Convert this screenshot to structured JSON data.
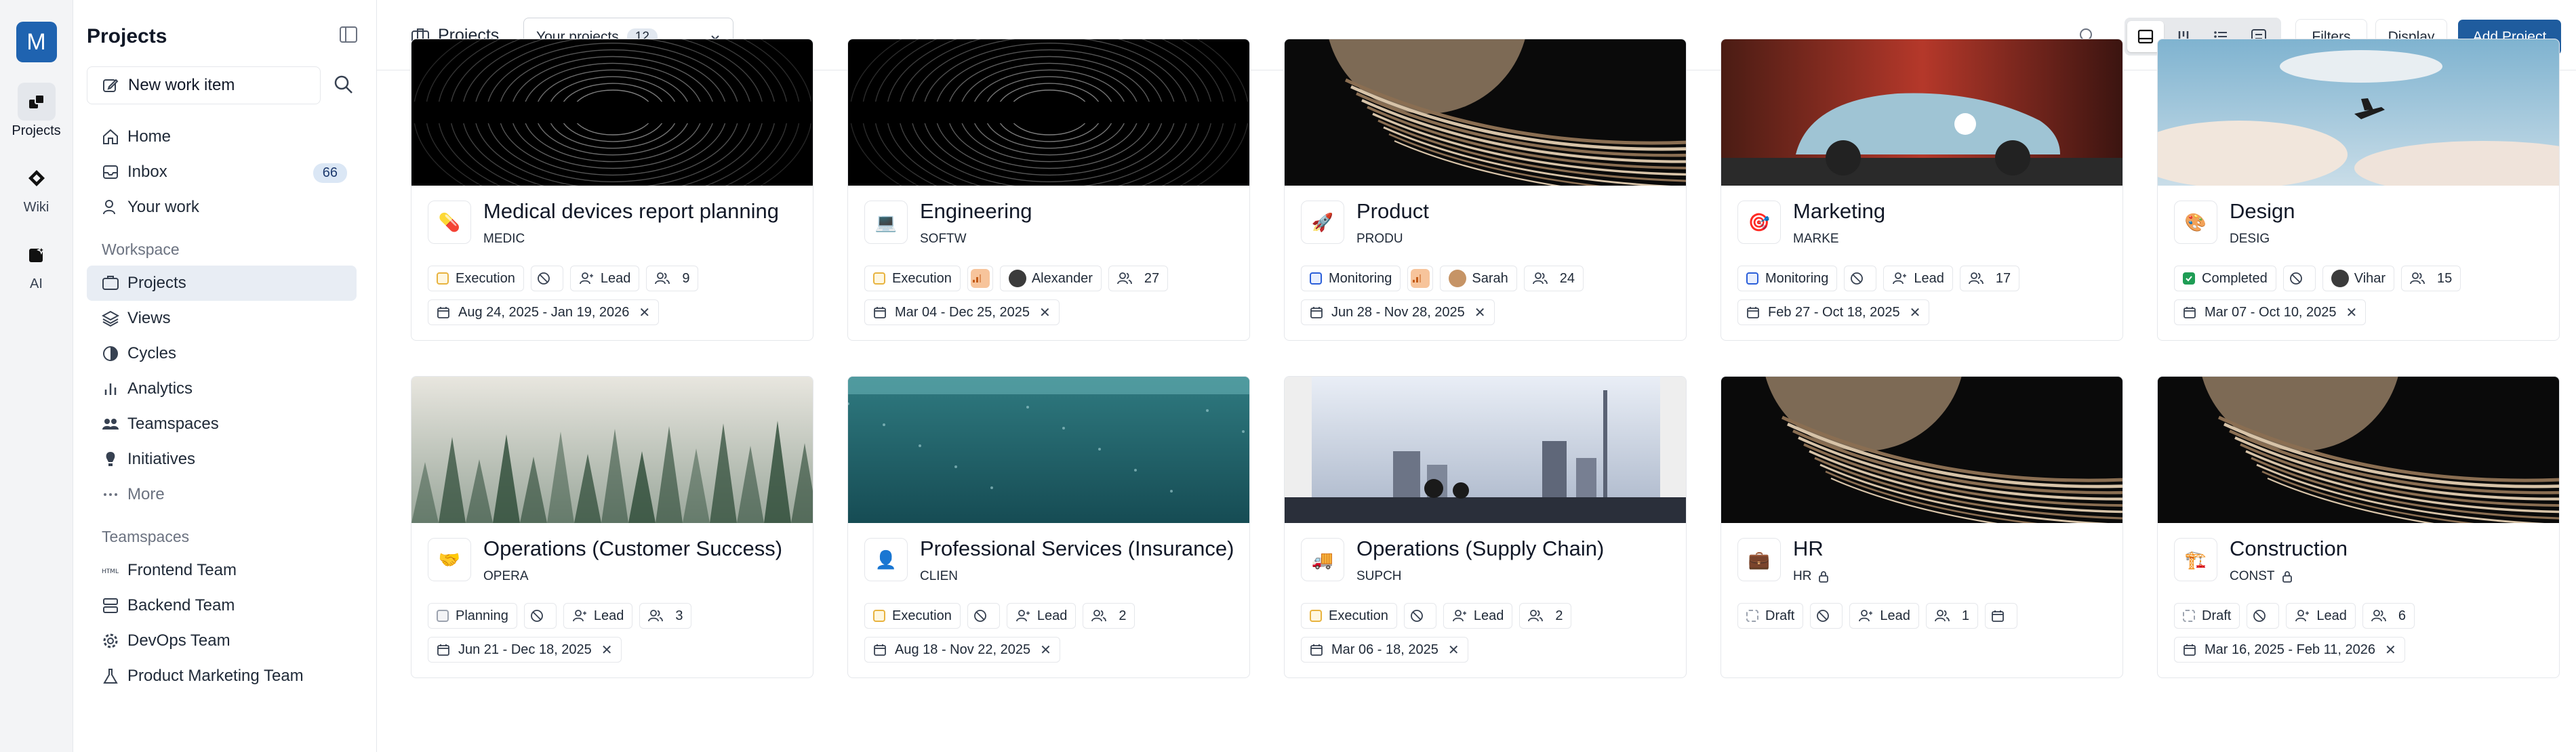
{
  "workspace": {
    "initial": "M"
  },
  "rail": [
    {
      "label": "Projects",
      "icon": "projects-icon",
      "active": true
    },
    {
      "label": "Wiki",
      "icon": "wiki-icon",
      "active": false
    },
    {
      "label": "AI",
      "icon": "ai-icon",
      "active": false
    }
  ],
  "sidebar": {
    "title": "Projects",
    "new_work_item": "New work item",
    "nav": [
      {
        "label": "Home",
        "icon": "home-icon"
      },
      {
        "label": "Inbox",
        "icon": "inbox-icon",
        "badge": "66"
      },
      {
        "label": "Your work",
        "icon": "user-icon"
      }
    ],
    "workspace_label": "Workspace",
    "workspace_items": [
      {
        "label": "Projects",
        "icon": "projects-icon",
        "active": true
      },
      {
        "label": "Views",
        "icon": "layers-icon"
      },
      {
        "label": "Cycles",
        "icon": "cycles-icon"
      },
      {
        "label": "Analytics",
        "icon": "analytics-icon"
      },
      {
        "label": "Teamspaces",
        "icon": "teamspaces-icon"
      },
      {
        "label": "Initiatives",
        "icon": "initiatives-icon"
      },
      {
        "label": "More",
        "icon": "more-icon"
      }
    ],
    "teamspaces_label": "Teamspaces",
    "teamspaces": [
      {
        "label": "Frontend Team",
        "icon": "html-icon"
      },
      {
        "label": "Backend Team",
        "icon": "server-icon"
      },
      {
        "label": "DevOps Team",
        "icon": "gear-icon"
      },
      {
        "label": "Product Marketing Team",
        "icon": "flask-icon"
      }
    ]
  },
  "topbar": {
    "title": "Projects",
    "filter_select": "Your projects",
    "filter_count": "12",
    "filters_label": "Filters",
    "display_label": "Display",
    "add_project_label": "Add Project"
  },
  "projects": [
    {
      "name": "Medical devices report planning",
      "identifier": "MEDIC",
      "emoji": "💊",
      "state": "Execution",
      "state_kind": "exec",
      "priority": "none",
      "lead": "Lead",
      "members": "9",
      "dates": "Aug 24, 2025 - Jan 19, 2026",
      "cover": "rings"
    },
    {
      "name": "Engineering",
      "identifier": "SOFTW",
      "emoji": "💻",
      "state": "Execution",
      "state_kind": "exec",
      "priority": "medium",
      "lead": "Alexander",
      "members": "27",
      "dates": "Mar 04 - Dec 25, 2025",
      "cover": "rings"
    },
    {
      "name": "Product",
      "identifier": "PRODU",
      "emoji": "🚀",
      "state": "Monitoring",
      "state_kind": "mon",
      "priority": "medium",
      "lead": "Sarah",
      "members": "24",
      "dates": "Jun 28 - Nov 28, 2025",
      "cover": "planet"
    },
    {
      "name": "Marketing",
      "identifier": "MARKE",
      "emoji": "🎯",
      "state": "Monitoring",
      "state_kind": "mon",
      "priority": "none",
      "lead": "Lead",
      "members": "17",
      "dates": "Feb 27 - Oct 18, 2025",
      "cover": "car"
    },
    {
      "name": "Design",
      "identifier": "DESIG",
      "emoji": "🎨",
      "state": "Completed",
      "state_kind": "done",
      "priority": "none",
      "lead": "Vihar",
      "members": "15",
      "dates": "Mar 07 - Oct 10, 2025",
      "cover": "sky"
    },
    {
      "name": "Operations (Customer Success)",
      "identifier": "OPERA",
      "emoji": "🤝",
      "state": "Planning",
      "state_kind": "plan",
      "priority": "none",
      "lead": "Lead",
      "members": "3",
      "dates": "Jun 21 - Dec 18, 2025",
      "cover": "forest"
    },
    {
      "name": "Professional Services (Insurance)",
      "identifier": "CLIEN",
      "emoji": "👤",
      "state": "Execution",
      "state_kind": "exec",
      "priority": "none",
      "lead": "Lead",
      "members": "2",
      "dates": "Aug 18 - Nov 22, 2025",
      "cover": "water"
    },
    {
      "name": "Operations (Supply Chain)",
      "identifier": "SUPCH",
      "emoji": "🚚",
      "state": "Execution",
      "state_kind": "exec",
      "priority": "none",
      "lead": "Lead",
      "members": "2",
      "dates": "Mar 06 - 18, 2025",
      "cover": "city"
    },
    {
      "name": "HR",
      "identifier": "HR",
      "emoji": "💼",
      "state": "Draft",
      "state_kind": "draft",
      "priority": "none",
      "lead": "Lead",
      "members": "1",
      "dates": "",
      "locked": true,
      "cover": "planet"
    },
    {
      "name": "Construction",
      "identifier": "CONST",
      "emoji": "🏗️",
      "state": "Draft",
      "state_kind": "draft",
      "priority": "none",
      "lead": "Lead",
      "members": "6",
      "dates": "Mar 16, 2025 - Feb 11, 2026",
      "locked": true,
      "cover": "planet"
    }
  ]
}
